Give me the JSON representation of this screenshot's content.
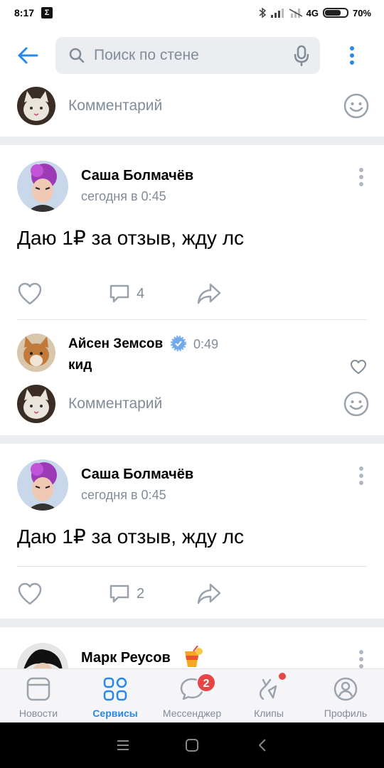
{
  "status_bar": {
    "time": "8:17",
    "network": "4G",
    "battery": "70%",
    "battery_level": 0.7
  },
  "header": {
    "search_placeholder": "Поиск по стене"
  },
  "comment_placeholder": "Комментарий",
  "posts": [
    {
      "author": "Саша Болмачёв",
      "time": "сегодня в 0:45",
      "text": "Даю 1₽ за отзыв, жду лс",
      "comments_count": "4",
      "comments": [
        {
          "author": "Айсен Земсов",
          "time": "0:49",
          "text": "кид"
        }
      ]
    },
    {
      "author": "Саша Болмачёв",
      "time": "сегодня в 0:45",
      "text": "Даю 1₽ за отзыв, жду лс",
      "comments_count": "2"
    },
    {
      "author": "Марк Реусов"
    }
  ],
  "tabbar": {
    "news": "Новости",
    "services": "Сервисы",
    "messenger": "Мессенджер",
    "messenger_badge": "2",
    "clips": "Клипы",
    "profile": "Профиль"
  },
  "colors": {
    "accent": "#2688eb",
    "secondary_text": "#818c99",
    "badge": "#e64646"
  }
}
